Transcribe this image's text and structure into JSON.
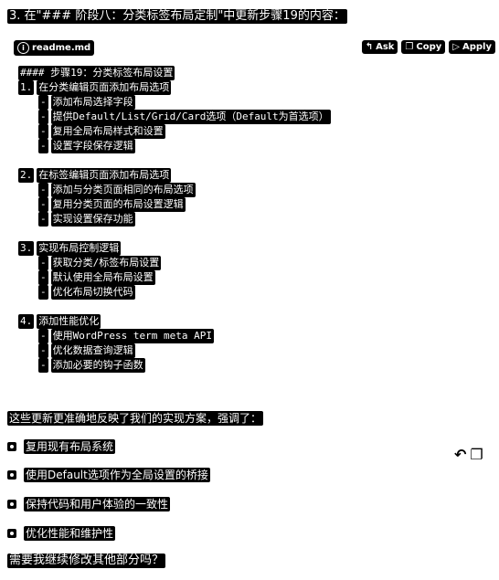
{
  "intro": "3. 在\"### 阶段八：分类标签布局定制\"中更新步骤19的内容：",
  "file": {
    "name": "readme.md",
    "icon": "info-icon"
  },
  "actions": {
    "ask": "Ask",
    "copy": "Copy",
    "apply": "Apply"
  },
  "code": [
    {
      "indent": 0,
      "mark": "",
      "text": "#### 步骤19：分类标签布局设置"
    },
    {
      "indent": 0,
      "mark": "1.",
      "text": "在分类编辑页面添加布局选项"
    },
    {
      "indent": 1,
      "mark": "-",
      "text": "添加布局选择字段"
    },
    {
      "indent": 1,
      "mark": "-",
      "text": "提供Default/List/Grid/Card选项（Default为首选项）"
    },
    {
      "indent": 1,
      "mark": "-",
      "text": "复用全局布局样式和设置"
    },
    {
      "indent": 1,
      "mark": "-",
      "text": "设置字段保存逻辑"
    },
    {
      "indent": -1,
      "mark": "",
      "text": ""
    },
    {
      "indent": 0,
      "mark": "2.",
      "text": "在标签编辑页面添加布局选项"
    },
    {
      "indent": 1,
      "mark": "-",
      "text": "添加与分类页面相同的布局选项"
    },
    {
      "indent": 1,
      "mark": "-",
      "text": "复用分类页面的布局设置逻辑"
    },
    {
      "indent": 1,
      "mark": "-",
      "text": "实现设置保存功能"
    },
    {
      "indent": -1,
      "mark": "",
      "text": ""
    },
    {
      "indent": 0,
      "mark": "3.",
      "text": "实现布局控制逻辑"
    },
    {
      "indent": 1,
      "mark": "-",
      "text": "获取分类/标签布局设置"
    },
    {
      "indent": 1,
      "mark": "-",
      "text": "默认使用全局布局设置"
    },
    {
      "indent": 1,
      "mark": "-",
      "text": "优化布局切换代码"
    },
    {
      "indent": -1,
      "mark": "",
      "text": ""
    },
    {
      "indent": 0,
      "mark": "4.",
      "text": "添加性能优化"
    },
    {
      "indent": 1,
      "mark": "-",
      "text": "使用WordPress term meta API"
    },
    {
      "indent": 1,
      "mark": "-",
      "text": "优化数据查询逻辑"
    },
    {
      "indent": 1,
      "mark": "-",
      "text": "添加必要的钩子函数"
    }
  ],
  "summary": "这些更新更准确地反映了我们的实现方案，强调了：",
  "bullets": [
    "复用现有布局系统",
    "使用Default选项作为全局设置的桥接",
    "保持代码和用户体验的一致性",
    "优化性能和维护性"
  ],
  "closing": "需要我继续修改其他部分吗？"
}
